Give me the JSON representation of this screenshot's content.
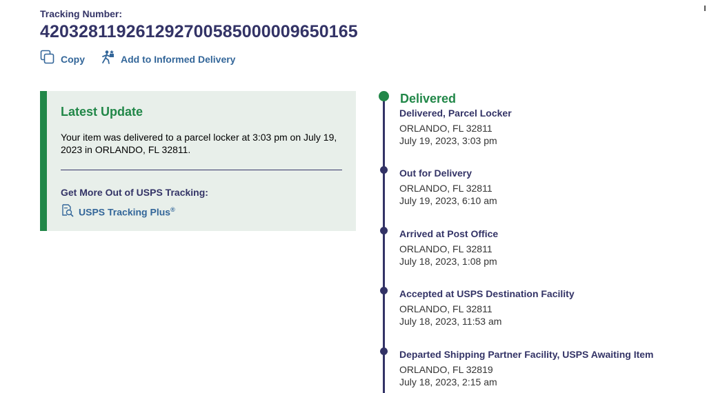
{
  "tracking": {
    "label": "Tracking Number:",
    "number": "420328119261292700585000009650165"
  },
  "actions": {
    "copy_label": "Copy",
    "informed_label": "Add to Informed Delivery"
  },
  "latest_update": {
    "title": "Latest Update",
    "text": "Your item was delivered to a parcel locker at 3:03 pm on July 19, 2023 in ORLANDO, FL 32811.",
    "more_label": "Get More Out of USPS Tracking:",
    "plus_link": "USPS Tracking Plus",
    "plus_mark": "®"
  },
  "timeline": {
    "current_status": "Delivered",
    "events": [
      {
        "title": "Delivered, Parcel Locker",
        "location": "ORLANDO, FL 32811",
        "datetime": "July 19, 2023, 3:03 pm"
      },
      {
        "title": "Out for Delivery",
        "location": "ORLANDO, FL 32811",
        "datetime": "July 19, 2023, 6:10 am"
      },
      {
        "title": "Arrived at Post Office",
        "location": "ORLANDO, FL 32811",
        "datetime": "July 18, 2023, 1:08 pm"
      },
      {
        "title": "Accepted at USPS Destination Facility",
        "location": "ORLANDO, FL 32811",
        "datetime": "July 18, 2023, 11:53 am"
      },
      {
        "title": "Departed Shipping Partner Facility, USPS Awaiting Item",
        "location": "ORLANDO, FL 32819",
        "datetime": "July 18, 2023, 2:15 am"
      }
    ]
  },
  "icons": {
    "copy": "copy-icon",
    "informed": "mail-carrier-icon",
    "plus": "tracking-plus-icon"
  },
  "colors": {
    "navy": "#333366",
    "link_blue": "#336699",
    "delivered_green": "#218748",
    "update_bg": "#e8efea"
  }
}
